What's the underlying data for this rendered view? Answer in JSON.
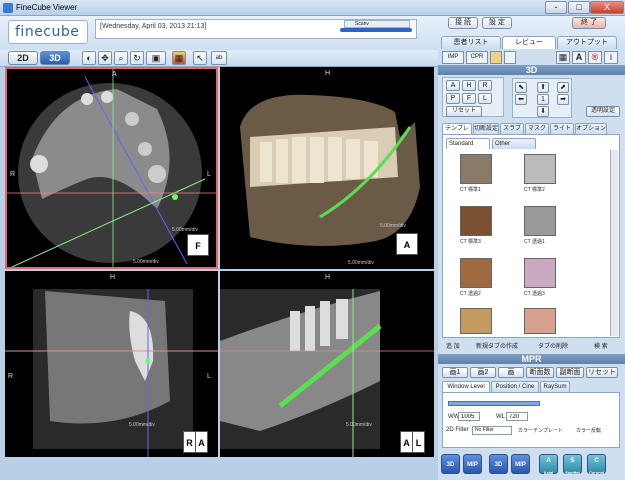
{
  "window": {
    "title": "FineCube Viewer",
    "min_label": "-",
    "max_label": "□",
    "close_label": "X"
  },
  "header": {
    "logo": "finecube",
    "date": "[Wednesday, April 03, 2013 21:13]",
    "slider_label": "Scanv",
    "btn_setting1": "接 続",
    "btn_setting2": "設 定",
    "btn_exit": "終 了",
    "tabs": [
      "患者リスト",
      "レビュー",
      "アウトプット"
    ]
  },
  "toolbar": {
    "btn_2d": "2D",
    "btn_3d": "3D",
    "right_btns": [
      "IMP",
      "CPR"
    ]
  },
  "viewports": {
    "axial": {
      "top": "A",
      "left": "R",
      "right": "L",
      "scale_y": "5.00mm/div",
      "scale_x": "5.00mm/div",
      "badge": "F"
    },
    "render3d": {
      "top": "H",
      "scale_y": "5.00mm/div",
      "scale_x": "5.00mm/div",
      "badge": "A"
    },
    "coronal": {
      "top": "H",
      "left": "R",
      "right": "L",
      "scale": "5.00mm/div",
      "badge_l": "R",
      "badge_r": "A"
    },
    "panoramic": {
      "top": "H",
      "scale": "5.00mm/div",
      "badge_l": "A",
      "badge_r": "L"
    }
  },
  "right_panel": {
    "section_3d": "3D",
    "orient": [
      "A",
      "H",
      "R",
      "P",
      "F",
      "L"
    ],
    "reset_label": "リセット",
    "vol_label": "透明設定",
    "tabs": [
      "テンプレート",
      "切断設定",
      "スラブ",
      "マスク",
      "ライト",
      "オプション"
    ],
    "subtabs": [
      "Standard",
      "Other"
    ],
    "thumbs": [
      "CT 標準1",
      "CT 標準2",
      "CT 標準3",
      "CT 透過1",
      "CT 透過2",
      "CT 透過3",
      "",
      ""
    ],
    "bottom_actions": [
      "追 加",
      "新規タブの作成",
      "タブの削除",
      "検 索"
    ],
    "section_mpr": "MPR",
    "mpr_btns": [
      "画1",
      "画2",
      "画",
      "断面数",
      "副断面",
      "リセット"
    ],
    "mpr_tabs": [
      "Window Level",
      "Position / Cine",
      "RaySum"
    ],
    "ww_label": "WW",
    "ww_value": "1005",
    "wl_label": "WL",
    "wl_value": "720",
    "filter_label": "2D Filter",
    "filter_value": "No Filter",
    "check1": "カラーテンプレート",
    "check2": "カラー反転",
    "bottom_btns": [
      "3D",
      "MIP",
      "3D",
      "MIP",
      "A",
      "S",
      "C"
    ],
    "bottom_sub": [
      "",
      "",
      "",
      "",
      "Axial",
      "Sagittal",
      "Coronal"
    ]
  }
}
